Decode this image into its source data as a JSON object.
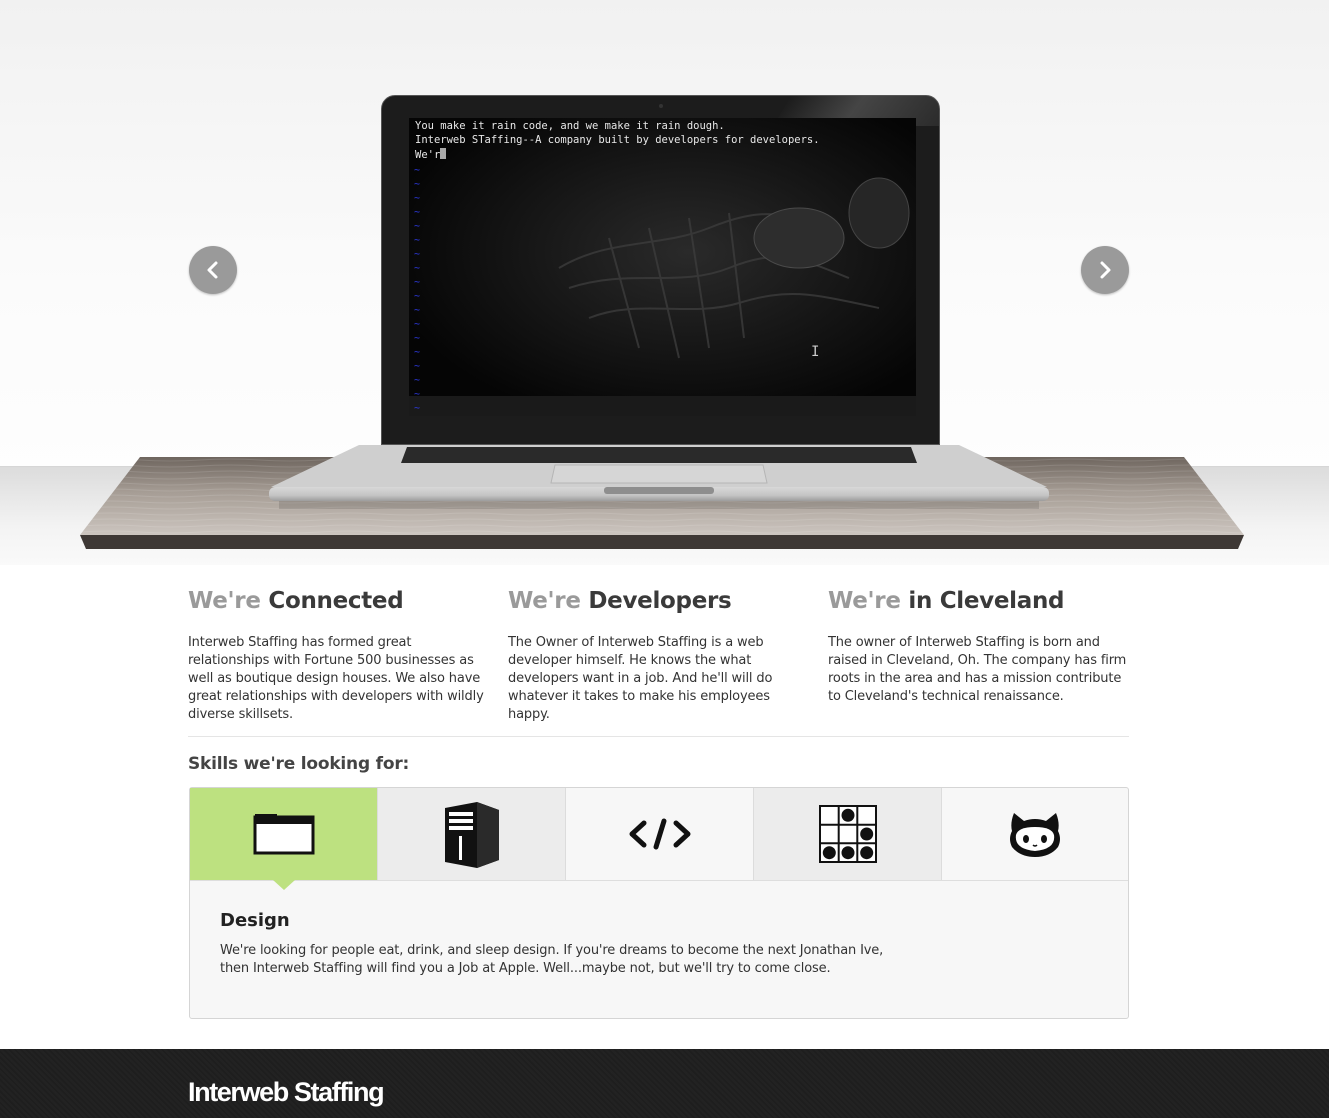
{
  "hero": {
    "terminal_lines": [
      "You make it rain code, and we make it rain dough.",
      "Interweb STaffing--A company built by developers for developers.",
      "We'r"
    ],
    "prev_icon": "chevron-left-icon",
    "next_icon": "chevron-right-icon"
  },
  "features": [
    {
      "prefix": "We're",
      "title": "Connected",
      "text": "Interweb Staffing has formed great relationships with Fortune 500 businesses as well as boutique design houses. We also have great relationships with developers with wildly diverse skillsets."
    },
    {
      "prefix": "We're",
      "title": "Developers",
      "text": "The Owner of Interweb Staffing is a web developer himself. He knows the what developers want in a job. And he'll will do whatever it takes to make his employees happy."
    },
    {
      "prefix": "We're",
      "title": "in Cleveland",
      "text": "The owner of Interweb Staffing is born and raised in Cleveland, Oh. The company has firm roots in the area and has a mission contribute to Cleveland's technical renaissance."
    }
  ],
  "skills": {
    "heading": "Skills we're looking for:",
    "tabs": [
      {
        "icon": "browser-window-icon",
        "active": true
      },
      {
        "icon": "server-tower-icon",
        "active": false
      },
      {
        "icon": "code-tag-icon",
        "active": false
      },
      {
        "icon": "glider-icon",
        "active": false
      },
      {
        "icon": "github-octocat-icon",
        "active": false
      }
    ],
    "active_color": "#bde180",
    "panel": {
      "title": "Design",
      "text": "We're looking for people eat, drink, and sleep design. If you're dreams to become the next Jonathan Ive, then Interweb Staffing will find you a Job at Apple. Well...maybe not, but we'll try to come close."
    }
  },
  "footer": {
    "brand": "Interweb Staffing"
  }
}
